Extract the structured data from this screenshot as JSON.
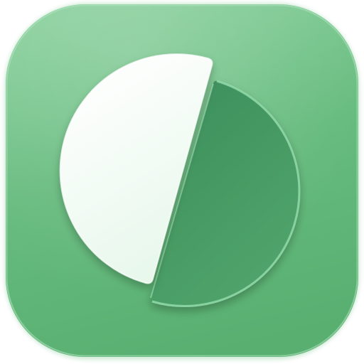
{
  "icon": {
    "name": "app-icon",
    "symbol": "split-circle-icon",
    "colors": {
      "tile_top": "#84CD98",
      "tile_mid": "#66BB7E",
      "tile_bottom": "#58AF70",
      "tile_rim": "#B3E4C1",
      "light_half_top": "#FFFFFF",
      "light_half_bottom": "#E6F7EA",
      "dark_half_top": "#3D8F5C",
      "dark_half_bottom": "#52A66C",
      "dark_half_edge": "#8ED7A7"
    }
  }
}
